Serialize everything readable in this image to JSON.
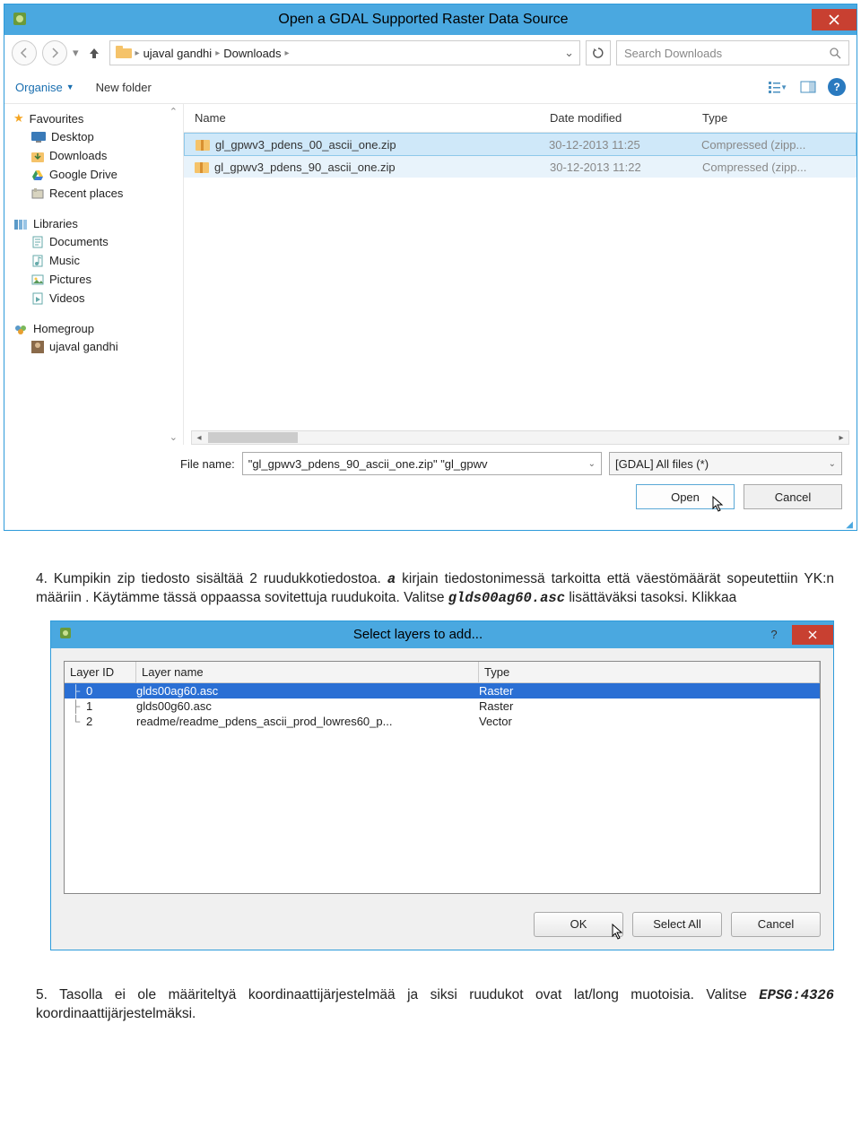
{
  "dialog1": {
    "title": "Open a GDAL Supported Raster Data Source",
    "breadcrumb": {
      "p1": "ujaval gandhi",
      "p2": "Downloads"
    },
    "search_placeholder": "Search Downloads",
    "organise": "Organise",
    "newfolder": "New folder",
    "headers": {
      "name": "Name",
      "date": "Date modified",
      "type": "Type"
    },
    "sidebar": {
      "favourites": "Favourites",
      "desktop": "Desktop",
      "downloads": "Downloads",
      "gdrive": "Google Drive",
      "recent": "Recent places",
      "libraries": "Libraries",
      "documents": "Documents",
      "music": "Music",
      "pictures": "Pictures",
      "videos": "Videos",
      "homegroup": "Homegroup",
      "user": "ujaval gandhi"
    },
    "files": [
      {
        "name": "gl_gpwv3_pdens_00_ascii_one.zip",
        "date": "30-12-2013 11:25",
        "type": "Compressed (zipp..."
      },
      {
        "name": "gl_gpwv3_pdens_90_ascii_one.zip",
        "date": "30-12-2013 11:22",
        "type": "Compressed (zipp..."
      }
    ],
    "filename_label": "File name:",
    "filename_value": "\"gl_gpwv3_pdens_90_ascii_one.zip\" \"gl_gpwv",
    "filter": "[GDAL] All files (*)",
    "open": "Open",
    "cancel": "Cancel"
  },
  "para4": {
    "num": "4.",
    "t1": "Kumpikin zip tiedosto sisältää 2 ruudukkotiedostoa. ",
    "a": "a",
    "t2": " kirjain tiedostonimessä tarkoitta että väestömäärät sopeutettiin YK:n määriin . Käytämme tässä oppaassa sovitettuja ruudukoita. Valitse ",
    "file": "glds00ag60.asc",
    "t3": " lisättäväksi tasoksi. Klikkaa"
  },
  "dialog2": {
    "title": "Select layers to add...",
    "headers": {
      "id": "Layer ID",
      "name": "Layer name",
      "type": "Type"
    },
    "rows": [
      {
        "id": "0",
        "name": "glds00ag60.asc",
        "type": "Raster"
      },
      {
        "id": "1",
        "name": "glds00g60.asc",
        "type": "Raster"
      },
      {
        "id": "2",
        "name": "readme/readme_pdens_ascii_prod_lowres60_p...",
        "type": "Vector"
      }
    ],
    "ok": "OK",
    "selectall": "Select All",
    "cancel": "Cancel"
  },
  "para5": {
    "num": "5.",
    "t1": "Tasolla ei ole määriteltyä koordinaattijärjestelmää ja siksi ruudukot ovat lat/long muotoisia. Valitse ",
    "epsg": "EPSG:4326",
    "t2": " koordinaattijärjestelmäksi."
  }
}
